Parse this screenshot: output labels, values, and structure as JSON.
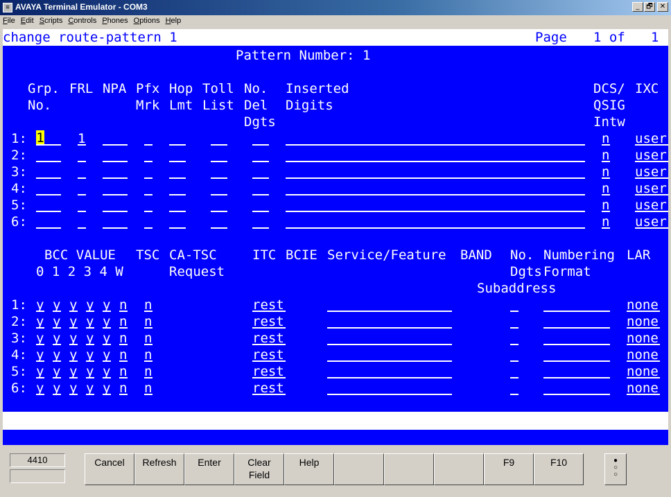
{
  "window": {
    "title": "AVAYA Terminal Emulator - COM3",
    "icon": "terminal-app-icon",
    "minimize": "_",
    "restore": "🗗",
    "close": "✕"
  },
  "menu": [
    "File",
    "Edit",
    "Scripts",
    "Controls",
    "Phones",
    "Options",
    "Help"
  ],
  "screen": {
    "command": "change route-pattern 1",
    "page_label": "Page",
    "page_num": "1 of",
    "page_total": "1",
    "pattern_number": "Pattern Number: 1",
    "headers_top": {
      "grp_no": "Grp.\nNo.",
      "frl": "FRL",
      "npa": "NPA",
      "pfx_mrk": "Pfx\nMrk",
      "hop_lmt": "Hop\nLmt",
      "toll_list": "Toll\nList",
      "no_del_dgts": "No.\nDel\nDgts",
      "inserted_digits": "Inserted\nDigits",
      "dcs_qsig": "DCS/\nQSIG\nIntw",
      "ixc": "IXC"
    },
    "rows_top": [
      {
        "n": "1:",
        "grp": "1",
        "frl": "1",
        "dcs": "n",
        "ixc": "user"
      },
      {
        "n": "2:",
        "grp": "",
        "frl": "",
        "dcs": "n",
        "ixc": "user"
      },
      {
        "n": "3:",
        "grp": "",
        "frl": "",
        "dcs": "n",
        "ixc": "user"
      },
      {
        "n": "4:",
        "grp": "",
        "frl": "",
        "dcs": "n",
        "ixc": "user"
      },
      {
        "n": "5:",
        "grp": "",
        "frl": "",
        "dcs": "n",
        "ixc": "user"
      },
      {
        "n": "6:",
        "grp": "",
        "frl": "",
        "dcs": "n",
        "ixc": "user"
      }
    ],
    "headers_bottom": {
      "bcc": "BCC VALUE\n0 1 2 3 4 W",
      "tsc": "TSC",
      "ca_tsc": "CA-TSC\nRequest",
      "itc": "ITC",
      "bcie": "BCIE",
      "service": "Service/Feature",
      "band": "BAND",
      "no_dgts": "No.\nDgts",
      "subaddress": "Subaddress",
      "numbering": "Numbering\nFormat",
      "lar": "LAR"
    },
    "rows_bottom": [
      {
        "n": "1:",
        "bcc": [
          "y",
          "y",
          "y",
          "y",
          "y",
          "n"
        ],
        "tsc": "n",
        "itc": "rest",
        "lar": "none"
      },
      {
        "n": "2:",
        "bcc": [
          "y",
          "y",
          "y",
          "y",
          "y",
          "n"
        ],
        "tsc": "n",
        "itc": "rest",
        "lar": "none"
      },
      {
        "n": "3:",
        "bcc": [
          "y",
          "y",
          "y",
          "y",
          "y",
          "n"
        ],
        "tsc": "n",
        "itc": "rest",
        "lar": "none"
      },
      {
        "n": "4:",
        "bcc": [
          "y",
          "y",
          "y",
          "y",
          "y",
          "n"
        ],
        "tsc": "n",
        "itc": "rest",
        "lar": "none"
      },
      {
        "n": "5:",
        "bcc": [
          "y",
          "y",
          "y",
          "y",
          "y",
          "n"
        ],
        "tsc": "n",
        "itc": "rest",
        "lar": "none"
      },
      {
        "n": "6:",
        "bcc": [
          "y",
          "y",
          "y",
          "y",
          "y",
          "n"
        ],
        "tsc": "n",
        "itc": "rest",
        "lar": "none"
      }
    ]
  },
  "statusbox": {
    "extension": "4410",
    "blank": ""
  },
  "fkeys": [
    {
      "label": "Cancel"
    },
    {
      "label": "Refresh"
    },
    {
      "label": "Enter"
    },
    {
      "label": "Clear\nField"
    },
    {
      "label": "Help"
    },
    {
      "label": ""
    },
    {
      "label": ""
    },
    {
      "label": ""
    },
    {
      "label": "F9"
    },
    {
      "label": "F10"
    }
  ],
  "indicator": {
    "icon": "page-dots-icon",
    "dots": [
      "●",
      "○",
      "○"
    ]
  }
}
